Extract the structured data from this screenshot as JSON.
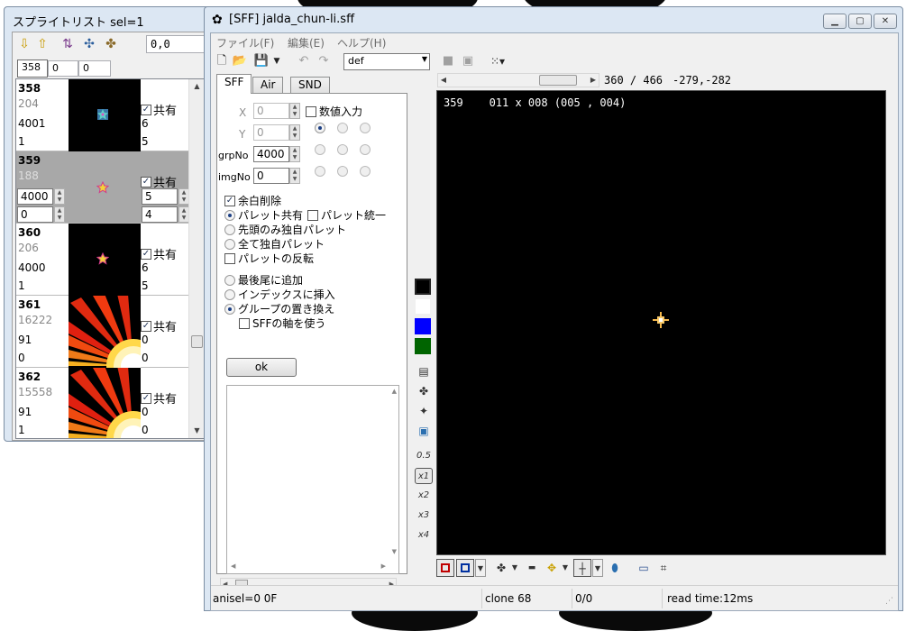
{
  "sprite_list": {
    "title": "スプライトリスト sel=1",
    "coord": "0,0",
    "fields": [
      "358",
      "0",
      "0"
    ],
    "rows": [
      {
        "num": "358",
        "sub": "204",
        "a": "4001",
        "b": "1",
        "share": "共有",
        "c": "6",
        "d": "5",
        "thumb": "star-teal",
        "selected": false
      },
      {
        "num": "359",
        "sub": "188",
        "a": "4000",
        "b": "0",
        "share": "共有",
        "c": "5",
        "d": "4",
        "thumb": "star-gold",
        "selected": true
      },
      {
        "num": "360",
        "sub": "206",
        "a": "4000",
        "b": "1",
        "share": "共有",
        "c": "6",
        "d": "5",
        "thumb": "star-gold",
        "selected": false
      },
      {
        "num": "361",
        "sub": "16222",
        "a": "91",
        "b": "0",
        "share": "共有",
        "c": "0",
        "d": "0",
        "thumb": "rays",
        "selected": false
      },
      {
        "num": "362",
        "sub": "15558",
        "a": "91",
        "b": "1",
        "share": "共有",
        "c": "0",
        "d": "0",
        "thumb": "rays",
        "selected": false
      }
    ]
  },
  "main": {
    "title": "[SFF] jalda_chun-li.sff",
    "menu": [
      "ファイル(F)",
      "編集(E)",
      "ヘルプ(H)"
    ],
    "combo_value": "def",
    "frame_info": "360 / 466",
    "xy_info": "-279,-282",
    "tabs": [
      "SFF",
      "Air",
      "SND"
    ],
    "form": {
      "x_label": "X",
      "x_value": "0",
      "y_label": "Y",
      "y_value": "0",
      "grp_label": "grpNo",
      "grp_value": "4000",
      "img_label": "imgNo",
      "img_value": "0",
      "numeric_input": "数値入力"
    },
    "options": {
      "trim": "余白削除",
      "palette_shared": "パレット共有",
      "palette_unify": "パレット統一",
      "first_only": "先頭のみ独自パレット",
      "all_own": "全て独自パレット",
      "palette_reverse": "パレットの反転",
      "append_last": "最後尾に追加",
      "insert_index": "インデックスに挿入",
      "replace_group": "グループの置き換え",
      "use_axis": "SFFの軸を使う"
    },
    "ok_label": "ok",
    "palette_colors": [
      "#000000",
      "#ffffff",
      "#0000ff",
      "#006400"
    ],
    "zoom_labels": [
      "0.5",
      "x1",
      "x2",
      "x3",
      "x4"
    ],
    "canvas_info": "359    011 x 008 (005 , 004)",
    "status": {
      "anisel": "anisel=0 0F",
      "clone": "clone 68",
      "count": "0/0",
      "read_time": "read time:12ms"
    }
  }
}
